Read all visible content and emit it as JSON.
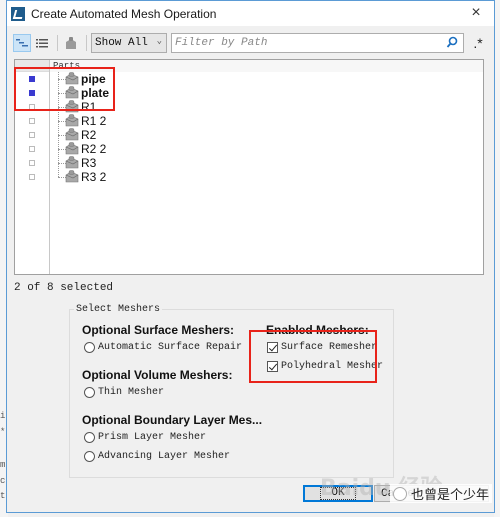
{
  "dialog": {
    "title": "Create Automated Mesh Operation",
    "close_label": "×"
  },
  "toolbar": {
    "filter_mode_selected": "Show All",
    "filter_placeholder": "Filter by Path",
    "regex_label": ".*"
  },
  "tree": {
    "header": "Parts",
    "items": [
      {
        "label": "pipe",
        "checked": true,
        "bold": true
      },
      {
        "label": "plate",
        "checked": true,
        "bold": true
      },
      {
        "label": "R1",
        "checked": false,
        "bold": false
      },
      {
        "label": "R1 2",
        "checked": false,
        "bold": false
      },
      {
        "label": "R2",
        "checked": false,
        "bold": false
      },
      {
        "label": "R2 2",
        "checked": false,
        "bold": false
      },
      {
        "label": "R3",
        "checked": false,
        "bold": false
      },
      {
        "label": "R3 2",
        "checked": false,
        "bold": false
      }
    ]
  },
  "status": {
    "selection_text": "2 of 8 selected"
  },
  "meshers": {
    "group_title": "Select Meshers",
    "optional_surface": {
      "heading": "Optional Surface Meshers:",
      "options": [
        "Automatic Surface Repair"
      ]
    },
    "optional_volume": {
      "heading": "Optional Volume Meshers:",
      "options": [
        "Thin Mesher"
      ]
    },
    "optional_boundary": {
      "heading": "Optional Boundary Layer Mes...",
      "options": [
        "Prism Layer Mesher",
        "Advancing Layer Mesher"
      ]
    },
    "enabled": {
      "heading": "Enabled Meshers:",
      "options": [
        {
          "label": "Surface Remesher",
          "checked": true
        },
        {
          "label": "Polyhedral Mesher",
          "checked": true
        }
      ]
    }
  },
  "buttons": {
    "ok": "OK",
    "cancel": "Cancel"
  },
  "watermark": {
    "brand": "Baidu 经验",
    "author": "也曾是个少年"
  },
  "colors": {
    "accent": "#0078d7",
    "highlight_box": "#e8231a",
    "checked_square": "#3a3ad0"
  }
}
